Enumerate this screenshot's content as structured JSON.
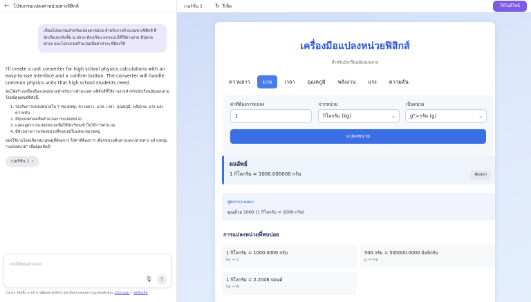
{
  "chat": {
    "header_title": "โปรแกรมแปลงค่าหน่วยทางฟิสิกส์",
    "user_message": "เขียนโปรแกรมสำหรับแปลงค่าหน่วย สำหรับการคำนวณทางฟิสิกส์ ที่นักเรียนระดับชั้น ม.ปลาย ต้องเรียน ออกแบบให้ใช้งานง่าย มีปุ่มกดตกลง และโปรแกรมคำนวณเป็นค่าต่างๆ ที่ต้องใช้",
    "assistant_intro": "I'll create a unit converter for high school physics calculations with an easy-to-use interface and a confirm button. The converter will handle common physics units that high school students need.",
    "assistant_th_intro": "ฉันได้สร้างเครื่องมือแปลงหน่วยสำหรับการคำนวณทางฟิสิกส์ที่ใช้งานง่ายสำหรับนักเรียนมัธยมปลาย โดยมีคุณสมบัติดังนี้:",
    "assistant_list": [
      "รองรับการแปลงหน่วยใน 7 หมวดหมู่: ความยาว, มวล, เวลา, อุณหภูมิ, พลังงาน, แรง และความดัน",
      "มีปุ่มกดตกลงเพื่อคำนวณการแปลงหน่วย",
      "แสดงสูตรการแปลงหน่วยเพื่อให้นักเรียนเข้าใจวิธีการคำนวณ",
      "มีตัวอย่างการแปลงหน่วยที่พบบ่อยในแต่ละหมวดหมู่"
    ],
    "assistant_outro": "ลองใช้งานโดยเลือกหมวดหมู่ที่ต้องการ ใส่ค่าที่ต้องการ เลือกหน่วยต้นทางและปลายทาง แล้วกดปุ่ม \"แปลงหน่วย\" เพื่อดูผลลัพธ์!",
    "version_chip": "เวอร์ชั่น 1",
    "composer_placeholder": "ถามได้ทุกอย่างเลย",
    "disclaimer": "Canva โค้ดดิ้ง อาจทำงานผิดพลาดได้บ้าง อย่าลืมตรวจสอบความถูกต้องด้วยนะ",
    "disclaimer_link1": "นโยบายนะ",
    "disclaimer_link2": "ส่งฟีดแบ็ค"
  },
  "topbar": {
    "version": "เวอร์ชั่น 1",
    "refresh": "รีเซ็ต",
    "use_button": "ใช้ในดีไซน์"
  },
  "app": {
    "title": "เครื่องมือแปลงหน่วยฟิสิกส์",
    "subtitle": "สำหรับนักเรียนมัธยมปลาย",
    "tabs": [
      "ความยาว",
      "มวล",
      "เวลา",
      "อุณหภูมิ",
      "พลังงาน",
      "แรง",
      "ความดัน"
    ],
    "active_tab": "มวล",
    "form": {
      "value_label": "ค่าที่ต้องการแปลง",
      "value": "1",
      "from_label": "จากหน่วย",
      "from_value": "กิโลกรัม (kg)",
      "to_label": "เป็นหน่วย",
      "to_value": "g\">กรัม (g)",
      "convert_button": "แปลงหน่วย"
    },
    "result": {
      "title": "ผลลัพธ์",
      "value": "1 กิโลกรัม = 1000.000000 กรัม",
      "copy": "คัดลอก"
    },
    "formula": {
      "title": "สูตรการแปลง:",
      "value": "คูณด้วย 1000 (1 กิโลกรัม = 1000 กรัม)"
    },
    "common": {
      "title": "การแปลงหน่วยที่พบบ่อย",
      "items": [
        {
          "main": "1 กิโลกรัม = 1000.0000 กรัม",
          "sub": "kg → g"
        },
        {
          "main": "500 กรัม = 500000.0000 มิลลิกรัม",
          "sub": "g → mg"
        },
        {
          "main": "1 กิโลกรัม = 2.2046 ปอนด์",
          "sub": "kg → lb"
        }
      ]
    }
  },
  "colors": {
    "accent": "#3b6fe4",
    "purple": "#7c5ce0"
  }
}
